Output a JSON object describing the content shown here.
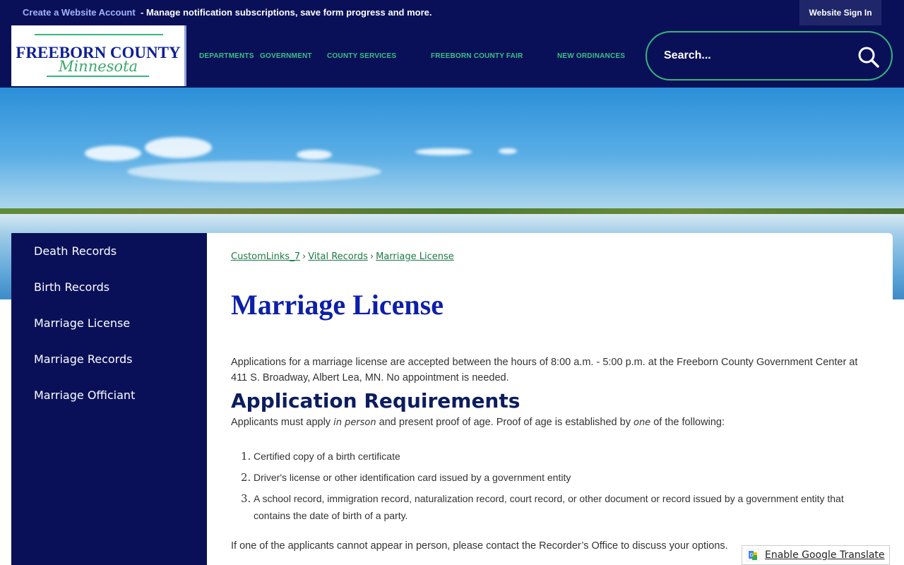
{
  "topbar": {
    "create_account": "Create a Website Account",
    "tagline": "- Manage notification subscriptions, save form progress and more.",
    "signin": "Website Sign In"
  },
  "logo": {
    "name": "FREEBORN COUNTY",
    "state": "Minnesota"
  },
  "nav": {
    "items": [
      "DEPARTMENTS",
      "GOVERNMENT",
      "COUNTY SERVICES",
      "FREEBORN COUNTY FAIR",
      "NEW ORDINANCES"
    ]
  },
  "search": {
    "placeholder": "Search..."
  },
  "sidebar": {
    "items": [
      "Death Records",
      "Birth Records",
      "Marriage License",
      "Marriage Records",
      "Marriage Officiant"
    ]
  },
  "breadcrumb": {
    "items": [
      "CustomLinks_7",
      "Vital Records",
      "Marriage License"
    ],
    "separator": "›"
  },
  "page": {
    "title": "Marriage License",
    "intro": "Applications for a marriage license are accepted between the hours of 8:00 a.m. - 5:00 p.m. at the Freeborn County Government Center at 411 S. Broadway, Albert Lea, MN.  No appointment is needed.",
    "requirements_heading": "Application Requirements",
    "requirements_text_a": "Applicants must apply ",
    "requirements_text_em1": "in person",
    "requirements_text_b": " and present proof of age. Proof of age is established by ",
    "requirements_text_em2": "one",
    "requirements_text_c": " of the following:",
    "list": [
      {
        "num": "1.",
        "text": "Certified copy of a birth certificate"
      },
      {
        "num": "2.",
        "text": "Driver's license or other identification card issued by a government entity"
      },
      {
        "num": "3.",
        "text": "A school record, immigration record, naturalization record, court record, or other document or record issued by a government entity that contains the date of birth of a party."
      }
    ],
    "final": "If one of the applicants cannot appear in person, please contact the Recorder’s Office to discuss your options."
  },
  "translate": {
    "label": "Enable Google Translate"
  },
  "colors": {
    "navy": "#0a1058",
    "accent_green": "#36b57f",
    "title_blue": "#0d1fa8"
  }
}
